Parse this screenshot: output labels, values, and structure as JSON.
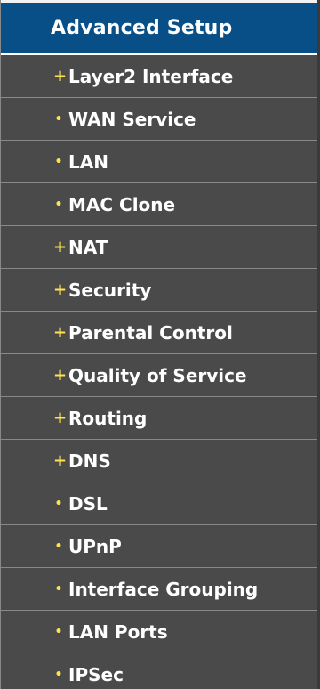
{
  "menu": {
    "header": "Advanced Setup",
    "colors": {
      "header_bg": "#074f86",
      "item_bg": "#4a4a4a",
      "marker": "#ffe24d",
      "text": "#ffffff"
    },
    "items": [
      {
        "label": "Layer2 Interface",
        "marker": "+",
        "marker_icon": "expand-plus-icon"
      },
      {
        "label": "WAN Service",
        "marker": "•",
        "marker_icon": "bullet-icon"
      },
      {
        "label": "LAN",
        "marker": "•",
        "marker_icon": "bullet-icon"
      },
      {
        "label": "MAC Clone",
        "marker": "•",
        "marker_icon": "bullet-icon"
      },
      {
        "label": "NAT",
        "marker": "+",
        "marker_icon": "expand-plus-icon"
      },
      {
        "label": "Security",
        "marker": "+",
        "marker_icon": "expand-plus-icon"
      },
      {
        "label": "Parental Control",
        "marker": "+",
        "marker_icon": "expand-plus-icon"
      },
      {
        "label": "Quality of Service",
        "marker": "+",
        "marker_icon": "expand-plus-icon"
      },
      {
        "label": "Routing",
        "marker": "+",
        "marker_icon": "expand-plus-icon"
      },
      {
        "label": "DNS",
        "marker": "+",
        "marker_icon": "expand-plus-icon"
      },
      {
        "label": "DSL",
        "marker": "•",
        "marker_icon": "bullet-icon"
      },
      {
        "label": "UPnP",
        "marker": "•",
        "marker_icon": "bullet-icon"
      },
      {
        "label": "Interface Grouping",
        "marker": "•",
        "marker_icon": "bullet-icon"
      },
      {
        "label": "LAN Ports",
        "marker": "•",
        "marker_icon": "bullet-icon"
      },
      {
        "label": "IPSec",
        "marker": "•",
        "marker_icon": "bullet-icon"
      }
    ]
  }
}
